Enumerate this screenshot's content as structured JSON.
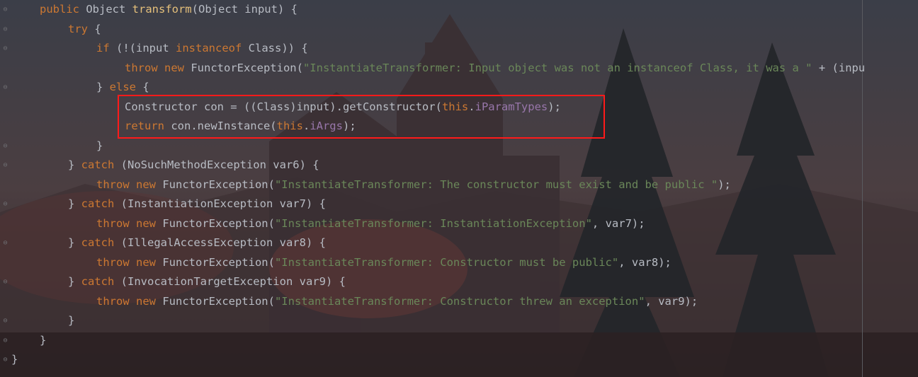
{
  "editor": {
    "lines": [
      {
        "indent": 1,
        "parts": [
          {
            "t": "public ",
            "c": "kw"
          },
          {
            "t": "Object ",
            "c": ""
          },
          {
            "t": "transform",
            "c": "fn"
          },
          {
            "t": "(Object input) {",
            "c": ""
          }
        ]
      },
      {
        "indent": 2,
        "parts": [
          {
            "t": "try",
            "c": "kw"
          },
          {
            "t": " {",
            "c": ""
          }
        ]
      },
      {
        "indent": 3,
        "parts": [
          {
            "t": "if",
            "c": "kw"
          },
          {
            "t": " (!(input ",
            "c": ""
          },
          {
            "t": "instanceof",
            "c": "kw"
          },
          {
            "t": " Class)) {",
            "c": ""
          }
        ]
      },
      {
        "indent": 4,
        "parts": [
          {
            "t": "throw ",
            "c": "kw"
          },
          {
            "t": "new ",
            "c": "kw"
          },
          {
            "t": "FunctorException(",
            "c": ""
          },
          {
            "t": "\"InstantiateTransformer: Input object was not an instanceof Class, it was a \"",
            "c": "str"
          },
          {
            "t": " + (inpu",
            "c": ""
          }
        ]
      },
      {
        "indent": 3,
        "parts": [
          {
            "t": "} ",
            "c": ""
          },
          {
            "t": "else",
            "c": "kw"
          },
          {
            "t": " {",
            "c": ""
          }
        ]
      },
      {
        "indent": 4,
        "parts": [
          {
            "t": "Constructor con = ((Class)input).getConstructor(",
            "c": ""
          },
          {
            "t": "this",
            "c": "kw"
          },
          {
            "t": ".",
            "c": ""
          },
          {
            "t": "iParamTypes",
            "c": "fld"
          },
          {
            "t": ");",
            "c": ""
          }
        ]
      },
      {
        "indent": 4,
        "parts": [
          {
            "t": "return ",
            "c": "kw"
          },
          {
            "t": "con.newInstance(",
            "c": ""
          },
          {
            "t": "this",
            "c": "kw"
          },
          {
            "t": ".",
            "c": ""
          },
          {
            "t": "iArgs",
            "c": "fld"
          },
          {
            "t": ");",
            "c": ""
          }
        ]
      },
      {
        "indent": 3,
        "parts": [
          {
            "t": "}",
            "c": ""
          }
        ]
      },
      {
        "indent": 2,
        "parts": [
          {
            "t": "} ",
            "c": ""
          },
          {
            "t": "catch",
            "c": "kw"
          },
          {
            "t": " (NoSuchMethodException var6) {",
            "c": ""
          }
        ]
      },
      {
        "indent": 3,
        "parts": [
          {
            "t": "throw ",
            "c": "kw"
          },
          {
            "t": "new ",
            "c": "kw"
          },
          {
            "t": "FunctorException(",
            "c": ""
          },
          {
            "t": "\"InstantiateTransformer: The constructor must exist and be public \"",
            "c": "str"
          },
          {
            "t": ");",
            "c": ""
          }
        ]
      },
      {
        "indent": 2,
        "parts": [
          {
            "t": "} ",
            "c": ""
          },
          {
            "t": "catch",
            "c": "kw"
          },
          {
            "t": " (InstantiationException var7) {",
            "c": ""
          }
        ]
      },
      {
        "indent": 3,
        "parts": [
          {
            "t": "throw ",
            "c": "kw"
          },
          {
            "t": "new ",
            "c": "kw"
          },
          {
            "t": "FunctorException(",
            "c": ""
          },
          {
            "t": "\"InstantiateTransformer: InstantiationException\"",
            "c": "str"
          },
          {
            "t": ", var7);",
            "c": ""
          }
        ]
      },
      {
        "indent": 2,
        "parts": [
          {
            "t": "} ",
            "c": ""
          },
          {
            "t": "catch",
            "c": "kw"
          },
          {
            "t": " (IllegalAccessException var8) {",
            "c": ""
          }
        ]
      },
      {
        "indent": 3,
        "parts": [
          {
            "t": "throw ",
            "c": "kw"
          },
          {
            "t": "new ",
            "c": "kw"
          },
          {
            "t": "FunctorException(",
            "c": ""
          },
          {
            "t": "\"InstantiateTransformer: Constructor must be public\"",
            "c": "str"
          },
          {
            "t": ", var8);",
            "c": ""
          }
        ]
      },
      {
        "indent": 2,
        "parts": [
          {
            "t": "} ",
            "c": ""
          },
          {
            "t": "catch",
            "c": "kw"
          },
          {
            "t": " (InvocationTargetException var9) {",
            "c": ""
          }
        ]
      },
      {
        "indent": 3,
        "parts": [
          {
            "t": "throw ",
            "c": "kw"
          },
          {
            "t": "new ",
            "c": "kw"
          },
          {
            "t": "FunctorException(",
            "c": ""
          },
          {
            "t": "\"InstantiateTransformer: Constructor threw an exception\"",
            "c": "str"
          },
          {
            "t": ", var9);",
            "c": ""
          }
        ]
      },
      {
        "indent": 2,
        "parts": [
          {
            "t": "}",
            "c": ""
          }
        ]
      },
      {
        "indent": 1,
        "parts": [
          {
            "t": "}",
            "c": ""
          }
        ]
      },
      {
        "indent": 0,
        "parts": [
          {
            "t": "}",
            "c": ""
          }
        ]
      }
    ]
  },
  "colors": {
    "keyword": "#cc7832",
    "method": "#e5c07b",
    "string": "#6a8759",
    "field": "#9876aa",
    "text": "#b8bcc4",
    "highlight_border": "#ff1a1a"
  },
  "icons": [
    "fold-marker-icon"
  ]
}
